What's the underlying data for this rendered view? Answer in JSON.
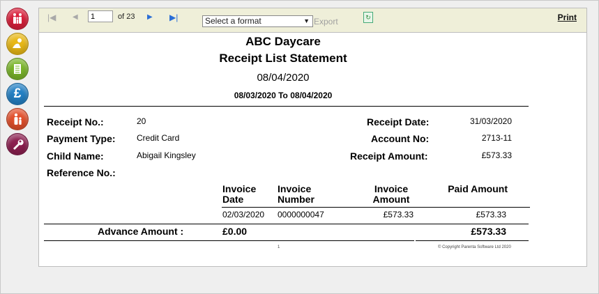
{
  "colors": {
    "toolbar_bg": "#efefd9",
    "nav_red": "#d9203b",
    "nav_yellow": "#e8b816",
    "nav_green": "#7ab52a",
    "nav_blue": "#2480c4",
    "nav_orange": "#e2502c",
    "nav_purple": "#8b1f4f"
  },
  "nav": [
    {
      "icon": "family-icon",
      "color": "#d9203b"
    },
    {
      "icon": "child-play-icon",
      "color": "#e8b816"
    },
    {
      "icon": "document-list-icon",
      "color": "#7ab52a"
    },
    {
      "icon": "pound-icon",
      "symbol": "£",
      "color": "#2480c4"
    },
    {
      "icon": "parent-child-icon",
      "color": "#e2502c"
    },
    {
      "icon": "wrench-icon",
      "color": "#8b1f4f"
    }
  ],
  "toolbar": {
    "first_icon": "first-page-icon",
    "prev_icon": "previous-page-icon",
    "page_value": "1",
    "page_of": "of 23",
    "next_icon": "next-page-icon",
    "last_icon": "last-page-icon",
    "format_placeholder": "Select a format",
    "export_label": "Export",
    "refresh_icon": "refresh-icon",
    "print_label": "Print"
  },
  "report": {
    "company": "ABC Daycare",
    "title": "Receipt List Statement",
    "print_date": "08/04/2020",
    "range_from": "08/03/2020",
    "range_to_word": "To",
    "range_to": "08/04/2020",
    "receipt_no_label": "Receipt No.:",
    "receipt_no": "20",
    "payment_type_label": "Payment Type:",
    "payment_type": "Credit Card",
    "child_name_label": "Child Name:",
    "child_name": "Abigail Kingsley",
    "reference_label": "Reference No.:",
    "receipt_date_label": "Receipt Date:",
    "receipt_date": "31/03/2020",
    "account_no_label": "Account No:",
    "account_no": "2713-11",
    "receipt_amount_label": "Receipt Amount:",
    "receipt_amount": "£573.33",
    "table": {
      "headers": [
        "Invoice Date",
        "Invoice Number",
        "Invoice Amount",
        "Paid Amount"
      ],
      "rows": [
        {
          "date": "02/03/2020",
          "number": "0000000047",
          "amount": "£573.33",
          "paid": "£573.33"
        }
      ]
    },
    "advance_label": "Advance Amount :",
    "advance_value": "£0.00",
    "total_paid": "£573.33",
    "page_number": "1",
    "copyright": "© Copyright Parenta Software Ltd 2020"
  }
}
